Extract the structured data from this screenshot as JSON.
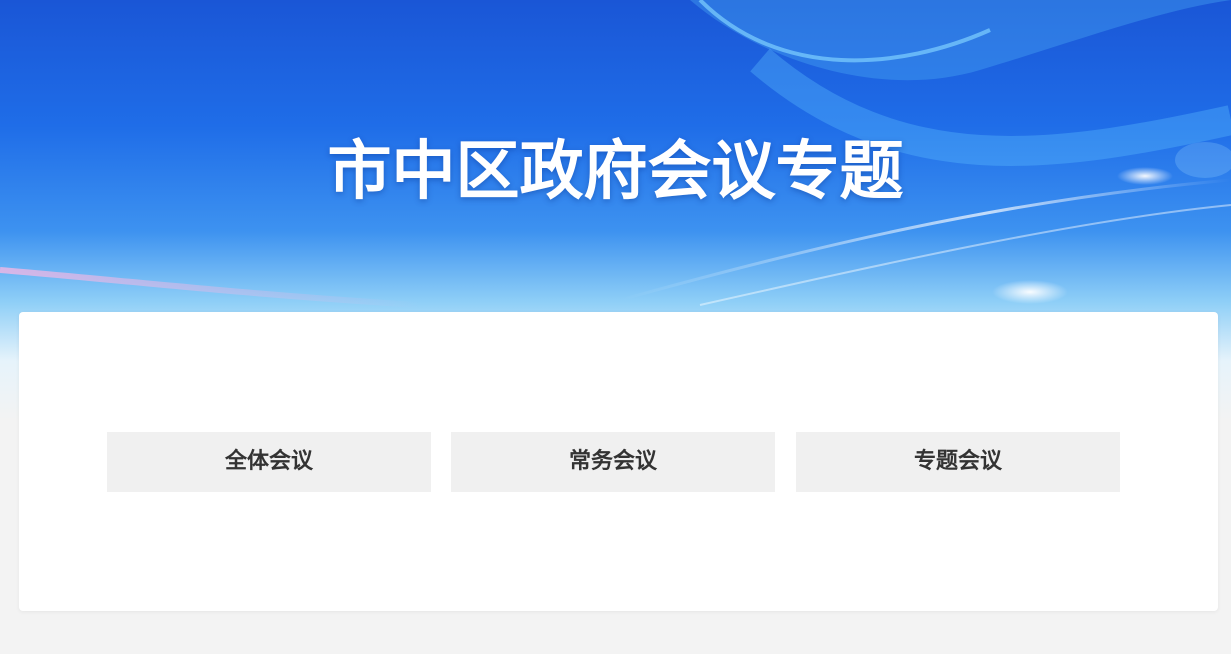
{
  "header": {
    "title": "市中区政府会议专题"
  },
  "meetings": {
    "tabs": [
      {
        "label": "全体会议"
      },
      {
        "label": "常务会议"
      },
      {
        "label": "专题会议"
      }
    ]
  },
  "colors": {
    "banner_top": "#1a56d6",
    "banner_mid": "#3d92f0",
    "page_background": "#f3f3f3",
    "card_background": "#ffffff",
    "tab_background": "#f0f0f0",
    "tab_text": "#333333",
    "title_text": "#ffffff"
  }
}
